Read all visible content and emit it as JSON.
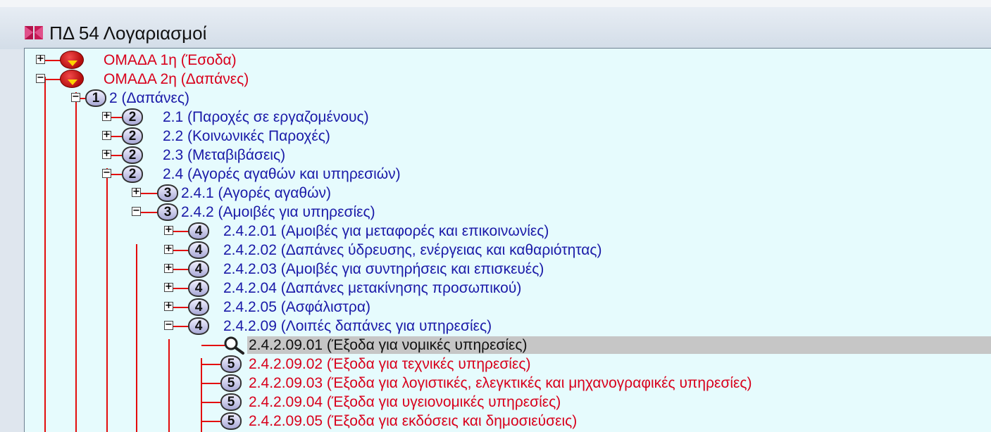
{
  "window": {
    "title": "ΠΔ 54 Λογαριασμοί"
  },
  "tree": {
    "rows": [
      {
        "label": "ΟΜΑΔΑ 1η  (Έσοδα)",
        "icon": "group-ball-icon",
        "expander": "+"
      },
      {
        "label": "ΟΜΑΔΑ 2η  (Δαπάνες)",
        "icon": "group-ball-icon",
        "expander": "−"
      },
      {
        "label": "2 (Δαπάνες)",
        "icon_text": "1",
        "expander": "−"
      },
      {
        "label": "2.1  (Παροχές σε εργαζομένους)",
        "icon_text": "2",
        "expander": "+"
      },
      {
        "label": "2.2  (Κοινωνικές Παροχές)",
        "icon_text": "2",
        "expander": "+"
      },
      {
        "label": "2.3  (Μεταβιβάσεις)",
        "icon_text": "2",
        "expander": "+"
      },
      {
        "label": "2.4  (Αγορές αγαθών και υπηρεσιών)",
        "icon_text": "2",
        "expander": "−"
      },
      {
        "label": "2.4.1  (Αγορές αγαθών)",
        "icon_text": "3",
        "expander": "+"
      },
      {
        "label": "2.4.2  (Αμοιβές για υπηρεσίες)",
        "icon_text": "3",
        "expander": "−"
      },
      {
        "label": "2.4.2.01  (Αμοιβές για μεταφορές και επικοινωνίες)",
        "icon_text": "4",
        "expander": "+"
      },
      {
        "label": "2.4.2.02  (Δαπάνες ύδρευσης, ενέργειας και καθαριότητας)",
        "icon_text": "4",
        "expander": "+"
      },
      {
        "label": "2.4.2.03  (Αμοιβές για συντηρήσεις και επισκευές)",
        "icon_text": "4",
        "expander": "+"
      },
      {
        "label": "2.4.2.04  (Δαπάνες μετακίνησης προσωπικού)",
        "icon_text": "4",
        "expander": "+"
      },
      {
        "label": "2.4.2.05  (Ασφάλιστρα)",
        "icon_text": "4",
        "expander": "+"
      },
      {
        "label": "2.4.2.09  (Λοιπές δαπάνες για υπηρεσίες)",
        "icon_text": "4",
        "expander": "−"
      },
      {
        "label": "2.4.2.09.01  (Έξοδα για νομικές υπηρεσίες)",
        "icon": "magnifier-icon",
        "selected": true
      },
      {
        "label": "2.4.2.09.02  (Έξοδα για τεχνικές υπηρεσίες)",
        "icon_text": "5"
      },
      {
        "label": "2.4.2.09.03  (Έξοδα για λογιστικές, ελεγκτικές και μηχανογραφικές υπηρεσίες)",
        "icon_text": "5"
      },
      {
        "label": "2.4.2.09.04  (Έξοδα για υγειονομικές υπηρεσίες)",
        "icon_text": "5"
      },
      {
        "label": "2.4.2.09.05  (Έξοδα για εκδόσεις και δημοσιεύσεις)",
        "icon_text": "5"
      }
    ]
  },
  "colors": {
    "tree_background": "#e6fbfd",
    "connector_red": "#e30b0b",
    "label_blue": "#1a1aa8",
    "label_red": "#d8001c",
    "selection_gray": "#c6c6c6"
  }
}
